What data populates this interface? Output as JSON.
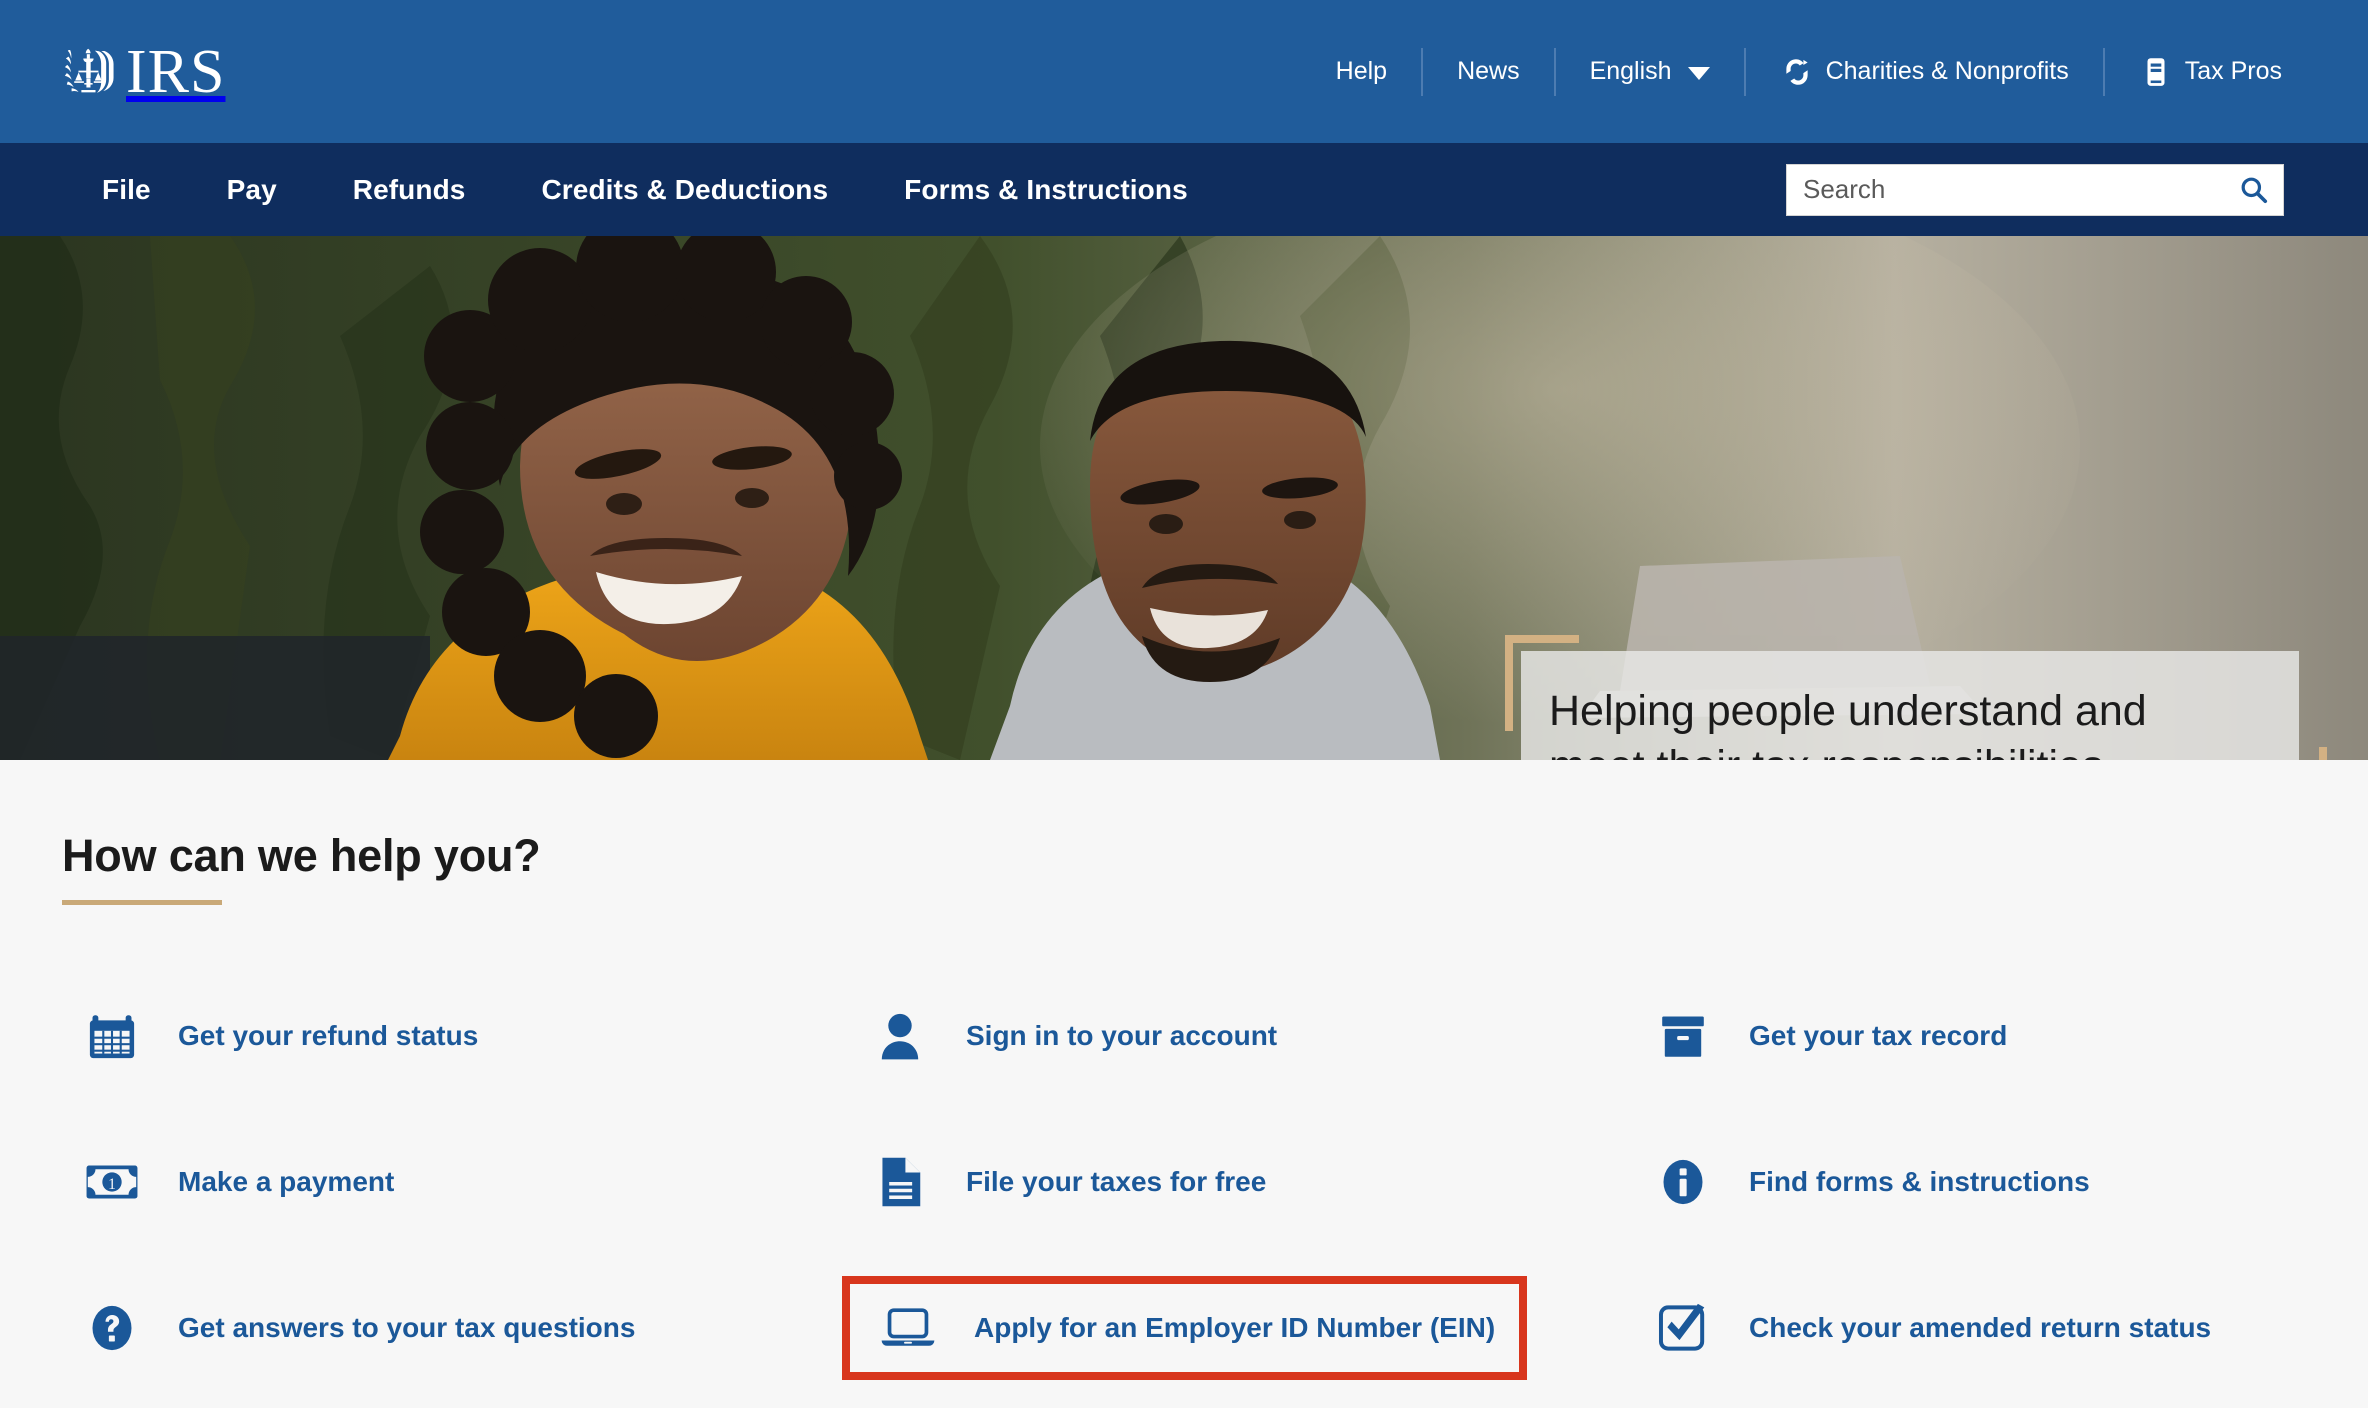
{
  "brand": {
    "logo_text": "IRS",
    "logo_icon": "irs-eagle-seal-icon",
    "top_bar_color": "#205c9b",
    "nav_bar_color": "#0f2d5e",
    "link_color": "#1b5899",
    "accent_gold": "#c9a978",
    "highlight_color": "#d8361d",
    "page_background": "#f7f7f7"
  },
  "utility_nav": {
    "items": [
      {
        "label": "Help",
        "icon": null
      },
      {
        "label": "News",
        "icon": null
      },
      {
        "label": "English",
        "icon": "chevron-down-icon"
      },
      {
        "label": "Charities & Nonprofits",
        "icon": "charities-ribbon-icon"
      },
      {
        "label": "Tax Pros",
        "icon": "tax-pros-card-icon"
      }
    ]
  },
  "main_nav": {
    "items": [
      {
        "label": "File"
      },
      {
        "label": "Pay"
      },
      {
        "label": "Refunds"
      },
      {
        "label": "Credits & Deductions"
      },
      {
        "label": "Forms & Instructions"
      }
    ]
  },
  "search": {
    "value": "",
    "placeholder": "Search",
    "icon": "search-icon",
    "button_label": "Search"
  },
  "hero": {
    "headline_line1": "Helping people understand and",
    "headline_line2": "meet their tax responsibilities",
    "image_alt": "Two smiling people sitting outdoors in front of a green hedge with a laptop"
  },
  "help": {
    "title": "How can we help you?",
    "columns": [
      {
        "items": [
          {
            "label": "Get your refund status",
            "icon": "calendar-icon"
          },
          {
            "label": "Make a payment",
            "icon": "dollar-bill-icon"
          },
          {
            "label": "Get answers to your tax questions",
            "icon": "question-circle-icon"
          }
        ]
      },
      {
        "items": [
          {
            "label": "Sign in to your account",
            "icon": "person-icon"
          },
          {
            "label": "File your taxes for free",
            "icon": "document-icon"
          },
          {
            "label": "Apply for an Employer ID Number (EIN)",
            "icon": "laptop-icon",
            "highlighted": true
          }
        ]
      },
      {
        "items": [
          {
            "label": "Get your tax record",
            "icon": "archive-box-icon"
          },
          {
            "label": "Find forms & instructions",
            "icon": "info-circle-icon"
          },
          {
            "label": "Check your amended return status",
            "icon": "checkbox-check-icon"
          }
        ]
      }
    ]
  }
}
